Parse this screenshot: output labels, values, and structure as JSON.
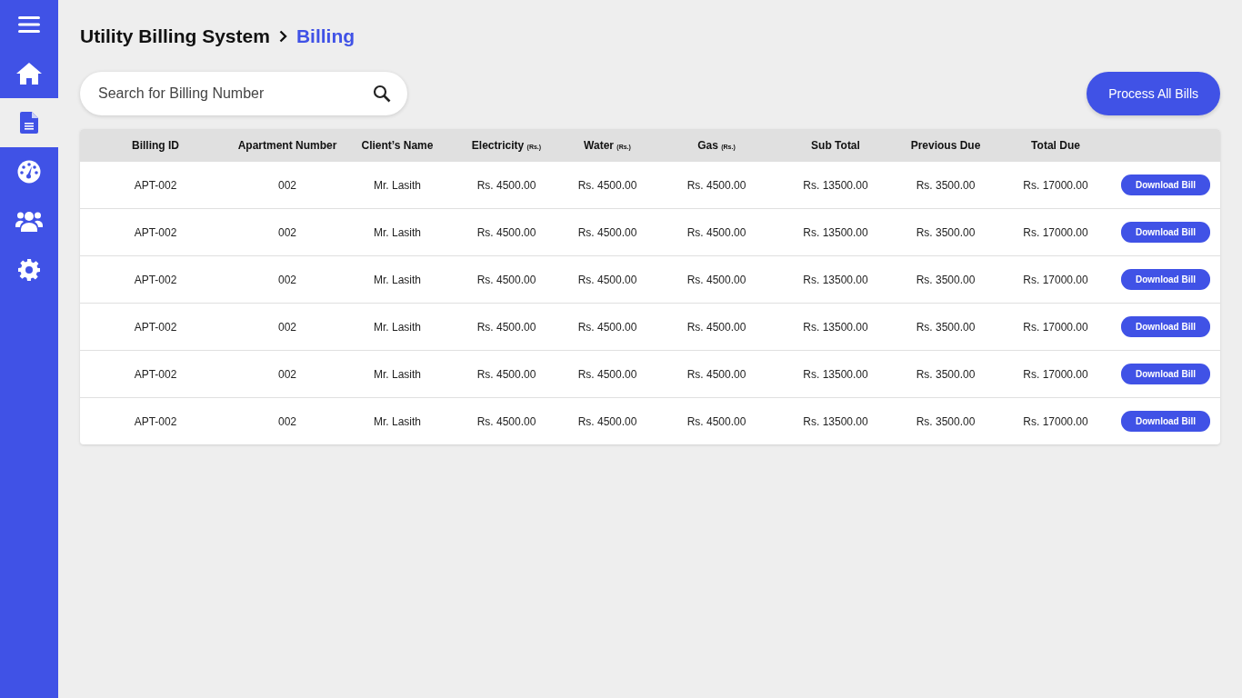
{
  "sidebar": {
    "items": [
      {
        "kind": "home",
        "selected": false
      },
      {
        "kind": "document",
        "selected": true
      },
      {
        "kind": "gauge",
        "selected": false
      },
      {
        "kind": "users",
        "selected": false
      },
      {
        "kind": "settings",
        "selected": false
      }
    ]
  },
  "breadcrumb": [
    {
      "label": "Utility Billing System",
      "current": false
    },
    {
      "label": "Billing",
      "current": true
    }
  ],
  "search": {
    "placeholder": "Search for Billing Number"
  },
  "process_button": "Process All Bills",
  "table": {
    "columns": [
      {
        "label": "Billing ID"
      },
      {
        "label": "Apartment Number"
      },
      {
        "label": "Client’s Name"
      },
      {
        "label": "Electricity",
        "unit": "(Rs.)"
      },
      {
        "label": "Water",
        "unit": "(Rs.)"
      },
      {
        "label": "Gas",
        "unit": "(Rs.)"
      },
      {
        "label": "Sub Total"
      },
      {
        "label": "Previous Due"
      },
      {
        "label": "Total Due"
      }
    ],
    "rows": [
      {
        "cells": [
          "APT-002",
          "002",
          "Mr. Lasith",
          "Rs. 4500.00",
          "Rs. 4500.00",
          "Rs. 4500.00",
          "Rs. 13500.00",
          "Rs. 3500.00",
          "Rs. 17000.00"
        ],
        "action": "Download Bill"
      },
      {
        "cells": [
          "APT-002",
          "002",
          "Mr. Lasith",
          "Rs. 4500.00",
          "Rs. 4500.00",
          "Rs. 4500.00",
          "Rs. 13500.00",
          "Rs. 3500.00",
          "Rs. 17000.00"
        ],
        "action": "Download Bill"
      },
      {
        "cells": [
          "APT-002",
          "002",
          "Mr. Lasith",
          "Rs. 4500.00",
          "Rs. 4500.00",
          "Rs. 4500.00",
          "Rs. 13500.00",
          "Rs. 3500.00",
          "Rs. 17000.00"
        ],
        "action": "Download Bill"
      },
      {
        "cells": [
          "APT-002",
          "002",
          "Mr. Lasith",
          "Rs. 4500.00",
          "Rs. 4500.00",
          "Rs. 4500.00",
          "Rs. 13500.00",
          "Rs. 3500.00",
          "Rs. 17000.00"
        ],
        "action": "Download Bill"
      },
      {
        "cells": [
          "APT-002",
          "002",
          "Mr. Lasith",
          "Rs. 4500.00",
          "Rs. 4500.00",
          "Rs. 4500.00",
          "Rs. 13500.00",
          "Rs. 3500.00",
          "Rs. 17000.00"
        ],
        "action": "Download Bill"
      },
      {
        "cells": [
          "APT-002",
          "002",
          "Mr. Lasith",
          "Rs. 4500.00",
          "Rs. 4500.00",
          "Rs. 4500.00",
          "Rs. 13500.00",
          "Rs. 3500.00",
          "Rs. 17000.00"
        ],
        "action": "Download Bill"
      }
    ]
  }
}
